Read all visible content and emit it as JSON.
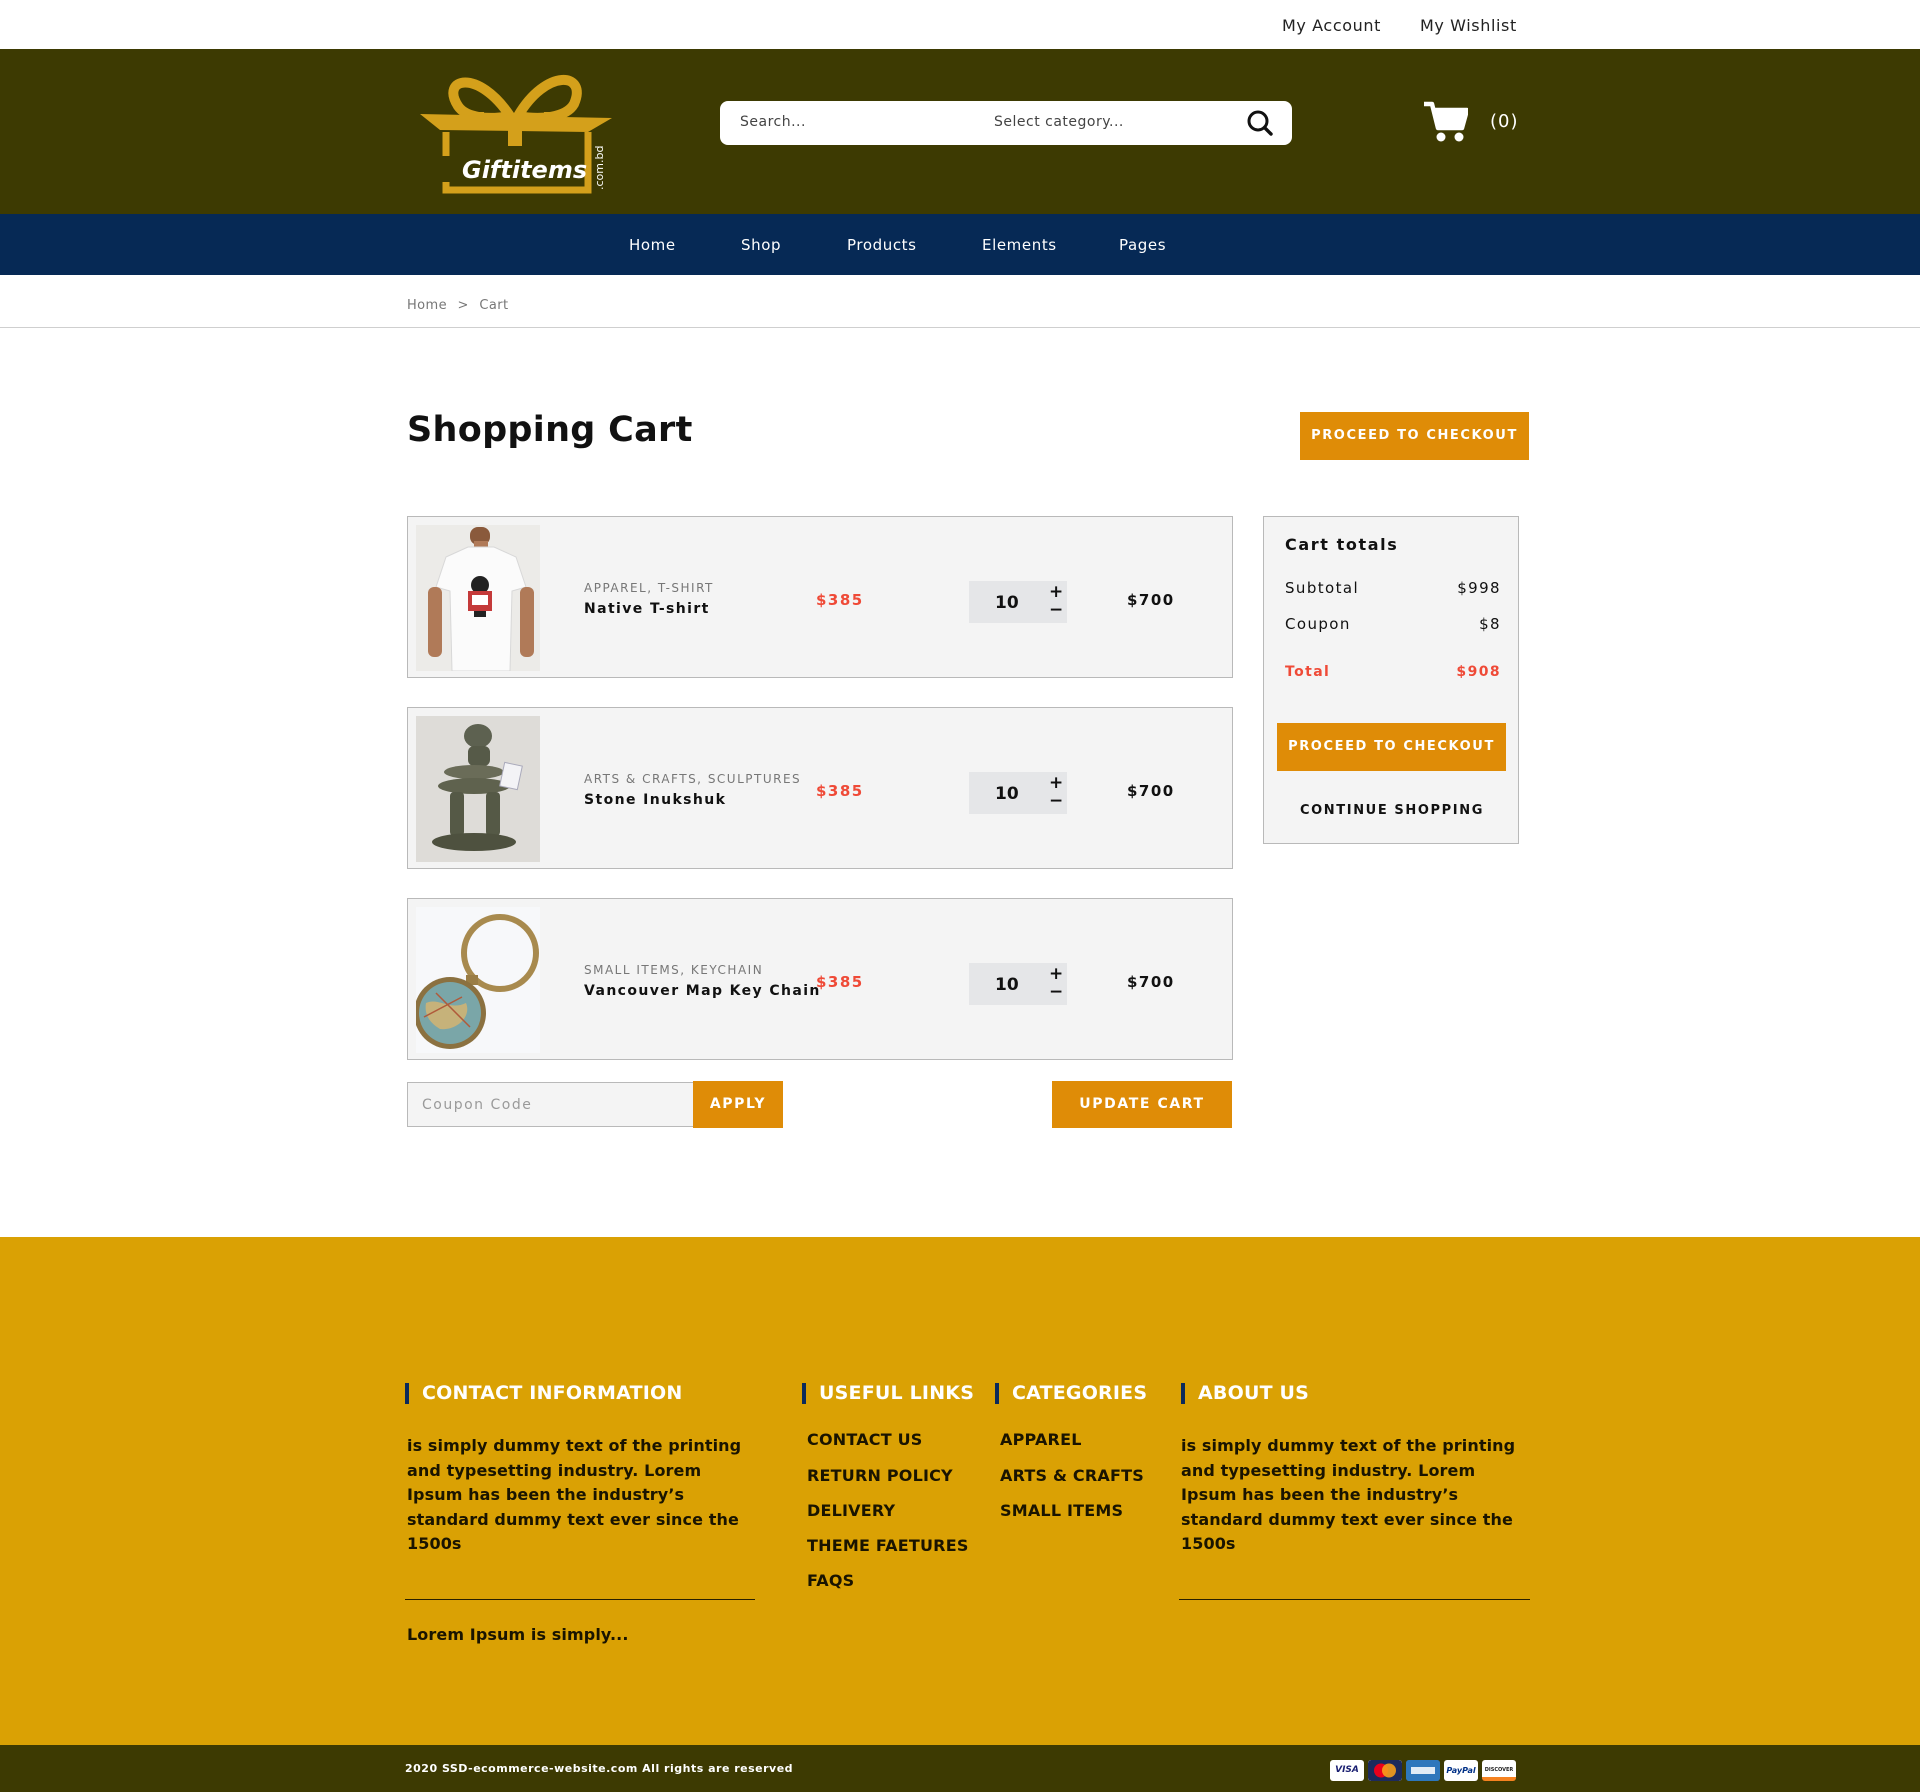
{
  "topbar": {
    "my_account": "My Account",
    "my_wishlist": "My Wishlist"
  },
  "header": {
    "logo_text": "Giftitems",
    "logo_suffix": ".com.bd",
    "search_placeholder": "Search...",
    "category_placeholder": "Select category...",
    "cart_count": "(0)"
  },
  "nav": {
    "items": [
      "Home",
      "Shop",
      "Products",
      "Elements",
      "Pages"
    ]
  },
  "breadcrumb": {
    "home": "Home",
    "sep": ">",
    "current": "Cart"
  },
  "page": {
    "title": "Shopping Cart",
    "checkout_label": "PROCEED TO CHECKOUT"
  },
  "cart": {
    "items": [
      {
        "category": "APPAREL, T-SHIRT",
        "name": "Native T-shirt",
        "price": "$385",
        "qty": "10",
        "total": "$700",
        "image": "tshirt"
      },
      {
        "category": "ARTS & CRAFTS, SCULPTURES",
        "name": "Stone Inukshuk",
        "price": "$385",
        "qty": "10",
        "total": "$700",
        "image": "inukshuk"
      },
      {
        "category": "SMALL ITEMS, KEYCHAIN",
        "name": "Vancouver Map Key Chain",
        "price": "$385",
        "qty": "10",
        "total": "$700",
        "image": "keychain"
      }
    ],
    "qty_plus": "+",
    "qty_minus": "−",
    "coupon_placeholder": "Coupon Code",
    "apply_label": "APPLY",
    "update_label": "UPDATE CART"
  },
  "totals": {
    "title": "Cart totals",
    "subtotal_label": "Subtotal",
    "subtotal": "$998",
    "coupon_label": "Coupon",
    "coupon": "$8",
    "total_label": "Total",
    "total": "$908",
    "checkout_label": "PROCEED TO CHECKOUT",
    "continue_label": "CONTINUE SHOPPING"
  },
  "footer": {
    "contact": {
      "heading": "CONTACT INFORMATION",
      "text": "is simply dummy text of the printing and typesetting industry. Lorem Ipsum has been the industry’s standard dummy text ever since the 1500s",
      "tagline": "Lorem Ipsum is simply..."
    },
    "useful_links": {
      "heading": "USEFUL LINKS",
      "items": [
        "CONTACT US",
        "RETURN POLICY",
        "DELIVERY",
        "THEME FAETURES",
        "FAQS"
      ]
    },
    "categories": {
      "heading": "CATEGORIES",
      "items": [
        "APPAREL",
        "ARTS & CRAFTS",
        "SMALL ITEMS"
      ]
    },
    "about": {
      "heading": "ABOUT US",
      "text": "is simply dummy text of the printing and typesetting industry. Lorem Ipsum has been the industry’s standard dummy text ever since the 1500s"
    },
    "copyright": "2020 SSD-ecommerce-website.com All rights are reserved",
    "payment_icons": [
      "VISA",
      "MC",
      "AMEX",
      "PayPal",
      "DISCOVER"
    ]
  },
  "colors": {
    "header_bg": "#3d3a02",
    "nav_bg": "#062955",
    "accent_orange": "#df8c07",
    "price_red": "#ef4a37",
    "footer_bg": "#daa104"
  }
}
